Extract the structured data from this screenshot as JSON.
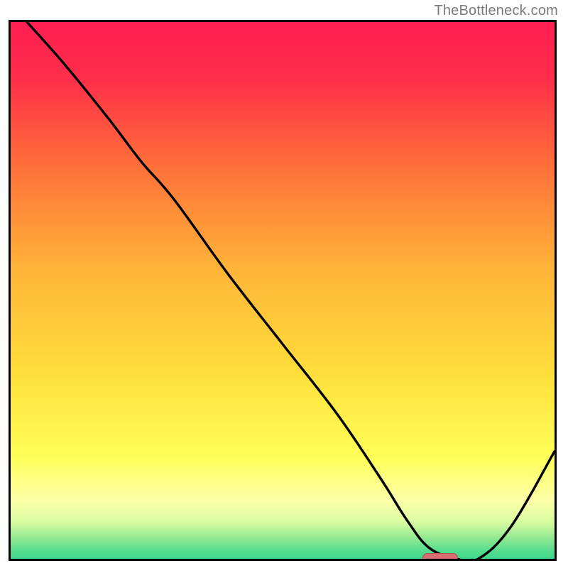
{
  "watermark": "TheBottleneck.com",
  "chart_data": {
    "type": "line",
    "title": "",
    "xlabel": "",
    "ylabel": "",
    "xlim": [
      0,
      100
    ],
    "ylim": [
      0,
      100
    ],
    "gradient_stops": [
      {
        "offset": 0.0,
        "color": "#ff1f52"
      },
      {
        "offset": 0.1,
        "color": "#ff2c4a"
      },
      {
        "offset": 0.25,
        "color": "#ff6a3a"
      },
      {
        "offset": 0.45,
        "color": "#ffb338"
      },
      {
        "offset": 0.65,
        "color": "#ffe03b"
      },
      {
        "offset": 0.8,
        "color": "#ffff58"
      },
      {
        "offset": 0.88,
        "color": "#fdffa8"
      },
      {
        "offset": 0.92,
        "color": "#d8fca0"
      },
      {
        "offset": 0.95,
        "color": "#8ee891"
      },
      {
        "offset": 0.975,
        "color": "#4fdc8e"
      },
      {
        "offset": 1.0,
        "color": "#2fd48d"
      }
    ],
    "series": [
      {
        "name": "bottleneck-curve",
        "x": [
          3,
          10,
          18,
          24,
          30,
          40,
          50,
          60,
          68,
          73,
          77,
          82,
          86,
          92,
          100
        ],
        "y": [
          100,
          92,
          82,
          74,
          67,
          53,
          40,
          27,
          15,
          7,
          2,
          0,
          0,
          6,
          20
        ]
      }
    ],
    "sweet_spot": {
      "x": 79,
      "y": 0
    }
  }
}
